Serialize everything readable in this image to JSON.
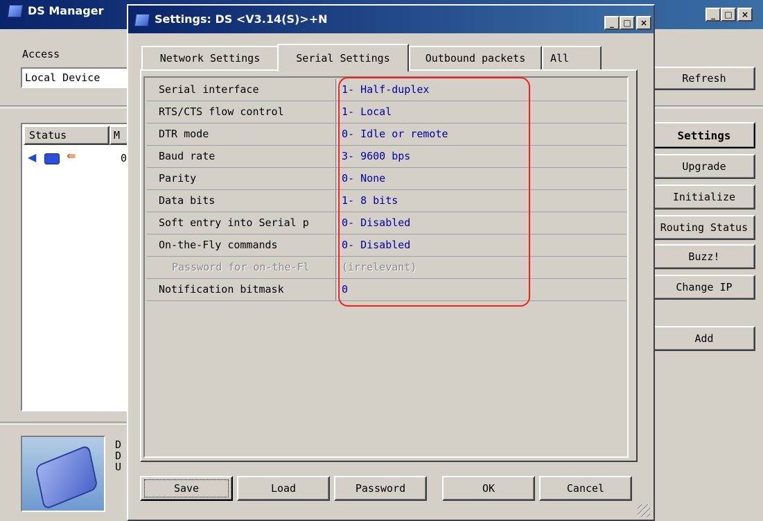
{
  "main_window": {
    "title": "DS Manager",
    "access_label": "Access",
    "access_value": "Local Device",
    "list_headers": [
      "Status",
      "M"
    ],
    "list_row_partial": "0",
    "info_partial": [
      "D",
      "D",
      "U"
    ],
    "buttons": {
      "refresh": "Refresh",
      "settings": "Settings",
      "upgrade": "Upgrade",
      "initialize": "Initialize",
      "routing_status": "Routing Status",
      "buzz": "Buzz!",
      "change_ip": "Change IP",
      "add": "Add"
    }
  },
  "settings_dialog": {
    "title": "Settings: DS <V3.14(S)>+N",
    "tabs": [
      {
        "label": "Network Settings",
        "active": false
      },
      {
        "label": "Serial Settings",
        "active": true
      },
      {
        "label": "Outbound packets",
        "active": false
      },
      {
        "label": "All",
        "active": false
      }
    ],
    "rows": [
      {
        "key": "Serial interface",
        "value": "1- Half-duplex",
        "disabled": false
      },
      {
        "key": "RTS/CTS flow control",
        "value": "1- Local",
        "disabled": false
      },
      {
        "key": "DTR mode",
        "value": "0- Idle or remote",
        "disabled": false
      },
      {
        "key": "Baud rate",
        "value": "3- 9600 bps",
        "disabled": false
      },
      {
        "key": "Parity",
        "value": "0- None",
        "disabled": false
      },
      {
        "key": "Data bits",
        "value": "1- 8 bits",
        "disabled": false
      },
      {
        "key": "Soft entry into Serial p",
        "value": "0- Disabled",
        "disabled": false
      },
      {
        "key": "On-the-Fly commands",
        "value": "0- Disabled",
        "disabled": false
      },
      {
        "key": "Password for on-the-Fl",
        "value": "(irrelevant)",
        "disabled": true
      },
      {
        "key": "Notification bitmask",
        "value": "0",
        "disabled": false
      }
    ],
    "buttons": {
      "save": "Save",
      "load": "Load",
      "password": "Password",
      "ok": "OK",
      "cancel": "Cancel"
    }
  },
  "caption_buttons": {
    "minimize": "_",
    "maximize": "□",
    "close": "×"
  },
  "colors": {
    "highlight": "#ff1a1a",
    "value_text": "#0000a0",
    "titlebar": "#0a246a"
  }
}
